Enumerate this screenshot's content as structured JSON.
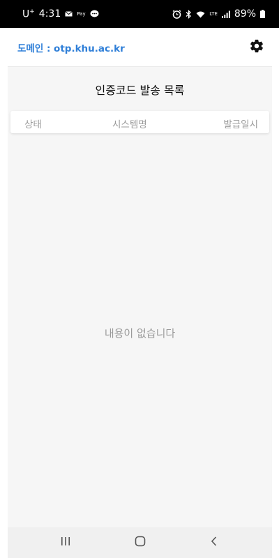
{
  "status_bar": {
    "carrier": "U",
    "carrier_sup": "+",
    "time": "4:31",
    "pay_label": "Pay",
    "network_label": "LTE",
    "battery": "89%"
  },
  "header": {
    "domain_label": "도메인 : otp.khu.ac.kr",
    "settings_icon": "gear-icon"
  },
  "main": {
    "title": "인증코드 발송 목록",
    "columns": [
      "상태",
      "시스템명",
      "발급일시"
    ],
    "empty_message": "내용이 없습니다"
  },
  "navigation": {
    "recent_icon": "recent-apps-icon",
    "home_icon": "home-icon",
    "back_icon": "back-icon"
  },
  "colors": {
    "accent": "#2f7fd8",
    "muted_text": "#9a9a9a",
    "background": "#f6f6f6"
  }
}
